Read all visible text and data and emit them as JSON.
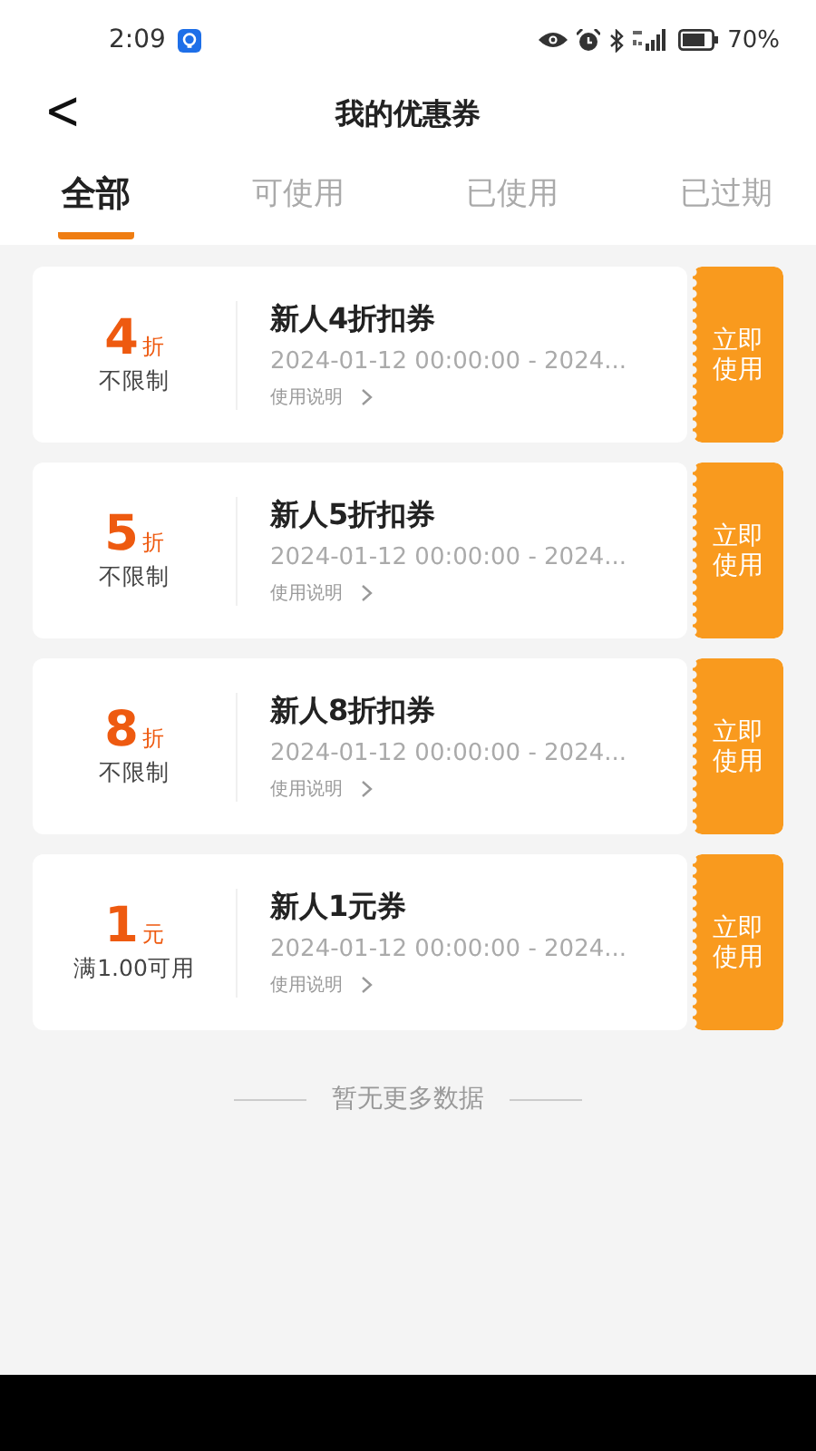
{
  "status_bar": {
    "time": "2:09",
    "battery": "70%"
  },
  "header": {
    "back": "<",
    "title": "我的优惠券"
  },
  "tabs": [
    {
      "label": "全部",
      "selected": true
    },
    {
      "label": "可使用",
      "selected": false
    },
    {
      "label": "已使用",
      "selected": false
    },
    {
      "label": "已过期",
      "selected": false
    }
  ],
  "coupons": [
    {
      "value": "4",
      "unit": "折",
      "condition": "不限制",
      "title": "新人4折扣券",
      "period": "2024-01-12 00:00:00 - 2024...",
      "details": "使用说明",
      "action": "立即使用"
    },
    {
      "value": "5",
      "unit": "折",
      "condition": "不限制",
      "title": "新人5折扣券",
      "period": "2024-01-12 00:00:00 - 2024...",
      "details": "使用说明",
      "action": "立即使用"
    },
    {
      "value": "8",
      "unit": "折",
      "condition": "不限制",
      "title": "新人8折扣券",
      "period": "2024-01-12 00:00:00 - 2024...",
      "details": "使用说明",
      "action": "立即使用"
    },
    {
      "value": "1",
      "unit": "元",
      "condition": "满1.00可用",
      "title": "新人1元券",
      "period": "2024-01-12 00:00:00 - 2024...",
      "details": "使用说明",
      "action": "立即使用"
    }
  ],
  "end_message": "暂无更多数据"
}
